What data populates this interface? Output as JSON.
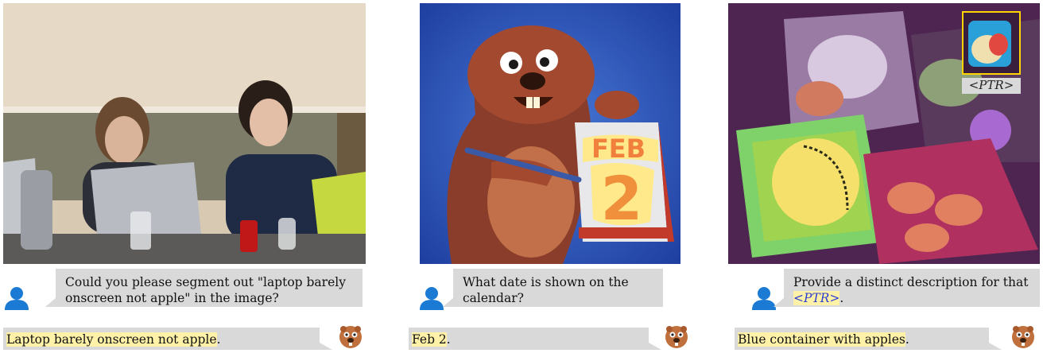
{
  "panels": [
    {
      "image_desc_icon": "photo-icon",
      "question": "Could you please segment out \"laptop barely onscreen not apple\" in the image?",
      "answer_highlight": "Laptop barely onscreen not apple",
      "answer_tail": "."
    },
    {
      "image_desc_icon": "photo-icon",
      "calendar_month": "FEB",
      "calendar_day": "2",
      "question": "What date is shown on the calendar?",
      "answer_highlight": "Feb 2",
      "answer_tail": "."
    },
    {
      "image_desc_icon": "photo-icon",
      "ptr_label": "<PTR>",
      "question_pre": "Provide a distinct description for that ",
      "question_ptr": "<PTR>",
      "question_post": ".",
      "answer_highlight": "Blue container with apples",
      "answer_tail": "."
    }
  ],
  "icons": {
    "user": "user-icon",
    "assistant": "beaver-avatar-icon"
  },
  "colors": {
    "user": "#1a7ad4",
    "bubble": "#d9d9d9",
    "highlight": "#fff2a8",
    "ptr_text": "#2a3fd4",
    "ptr_border": "#ffd400"
  }
}
